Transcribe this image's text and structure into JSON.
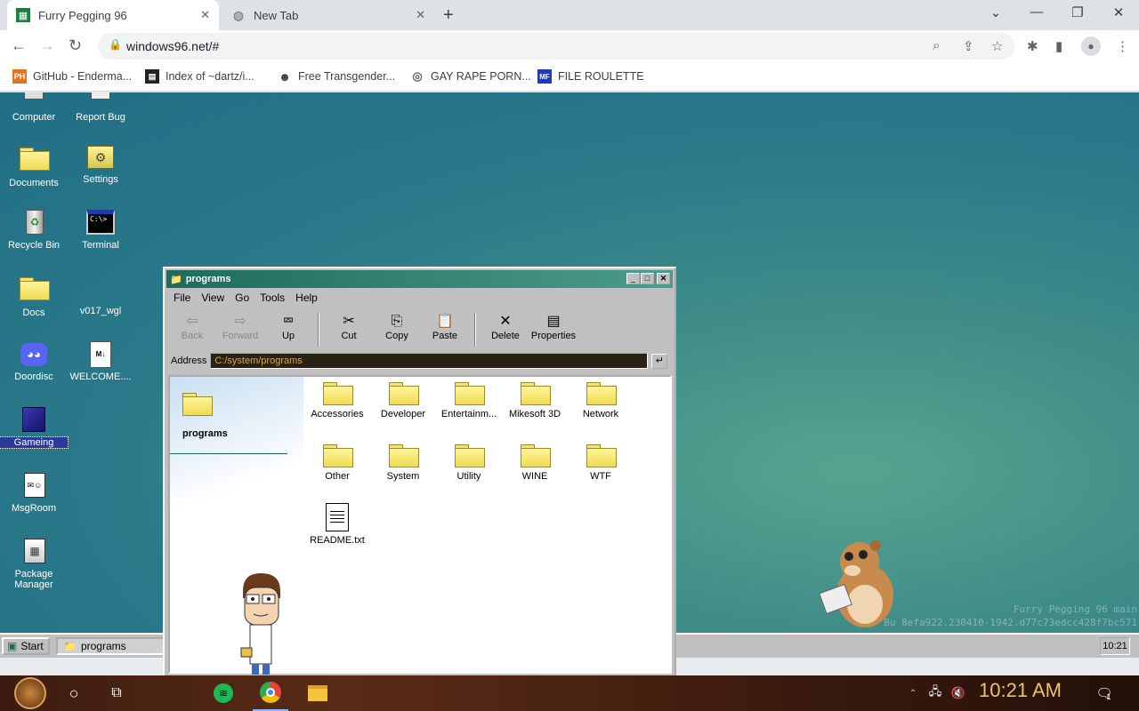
{
  "browser": {
    "tabs": [
      {
        "title": "Furry Pegging 96",
        "active": true,
        "icon": "spreadsheet-favicon-icon"
      },
      {
        "title": "New Tab",
        "active": false,
        "icon": "chrome-icon"
      }
    ],
    "url": "windows96.net/#",
    "bookmarks": [
      {
        "label": "GitHub - Enderma...",
        "icon": "ph-icon"
      },
      {
        "label": "Index of ~dartz/i...",
        "icon": "index-icon"
      },
      {
        "label": "Free Transgender...",
        "icon": "mask-icon"
      },
      {
        "label": "GAY RAPE PORN...",
        "icon": "globe-icon"
      },
      {
        "label": "FILE ROULETTE",
        "icon": "mf-icon"
      }
    ]
  },
  "desktop": {
    "icons": [
      {
        "label": "Computer",
        "icon": "computer-icon"
      },
      {
        "label": "Report Bug",
        "icon": "report-bug-icon"
      },
      {
        "label": "Documents",
        "icon": "documents-icon"
      },
      {
        "label": "Settings",
        "icon": "settings-icon"
      },
      {
        "label": "Recycle Bin",
        "icon": "recycle-bin-icon"
      },
      {
        "label": "Terminal",
        "icon": "terminal-icon"
      },
      {
        "label": "Docs",
        "icon": "folder-icon"
      },
      {
        "label": "v017_wgl",
        "icon": "blank-icon"
      },
      {
        "label": "Doordisc",
        "icon": "discord-icon"
      },
      {
        "label": "WELCOME....",
        "icon": "markdown-file-icon"
      },
      {
        "label": "Gameing",
        "icon": "game-box-icon",
        "selected": true
      },
      {
        "label": "MsgRoom",
        "icon": "msgroom-icon"
      },
      {
        "label": "Package Manager",
        "icon": "package-manager-icon"
      }
    ],
    "watermark_line1": "Furry Pegging 96 main",
    "watermark_line2": "Bu        8efa922.230410-1942.d77c73edcc428f7bc571"
  },
  "explorer": {
    "title": "programs",
    "menu": [
      "File",
      "View",
      "Go",
      "Tools",
      "Help"
    ],
    "toolbar": [
      {
        "label": "Back",
        "icon": "back-arrow-icon",
        "enabled": false
      },
      {
        "label": "Forward",
        "icon": "forward-arrow-icon",
        "enabled": false
      },
      {
        "label": "Up",
        "icon": "up-folder-icon",
        "enabled": true
      },
      {
        "label": "Cut",
        "icon": "scissors-icon",
        "enabled": true
      },
      {
        "label": "Copy",
        "icon": "copy-icon",
        "enabled": true
      },
      {
        "label": "Paste",
        "icon": "paste-icon",
        "enabled": true
      },
      {
        "label": "Delete",
        "icon": "delete-x-icon",
        "enabled": true
      },
      {
        "label": "Properties",
        "icon": "properties-icon",
        "enabled": true
      }
    ],
    "address_label": "Address",
    "address": "C:/system/programs",
    "sidebar_title": "programs",
    "items": [
      {
        "label": "Accessories",
        "type": "folder"
      },
      {
        "label": "Developer",
        "type": "folder"
      },
      {
        "label": "Entertainm...",
        "type": "folder"
      },
      {
        "label": "Mikesoft 3D",
        "type": "folder"
      },
      {
        "label": "Network",
        "type": "folder"
      },
      {
        "label": "Other",
        "type": "folder"
      },
      {
        "label": "System",
        "type": "folder"
      },
      {
        "label": "Utility",
        "type": "folder"
      },
      {
        "label": "WINE",
        "type": "folder"
      },
      {
        "label": "WTF",
        "type": "folder"
      },
      {
        "label": "README.txt",
        "type": "file"
      }
    ]
  },
  "taskbar96": {
    "start": "Start",
    "task": "programs",
    "clock": "10:21"
  },
  "windows_taskbar": {
    "clock": "10:21 AM",
    "notification_count": "1"
  }
}
